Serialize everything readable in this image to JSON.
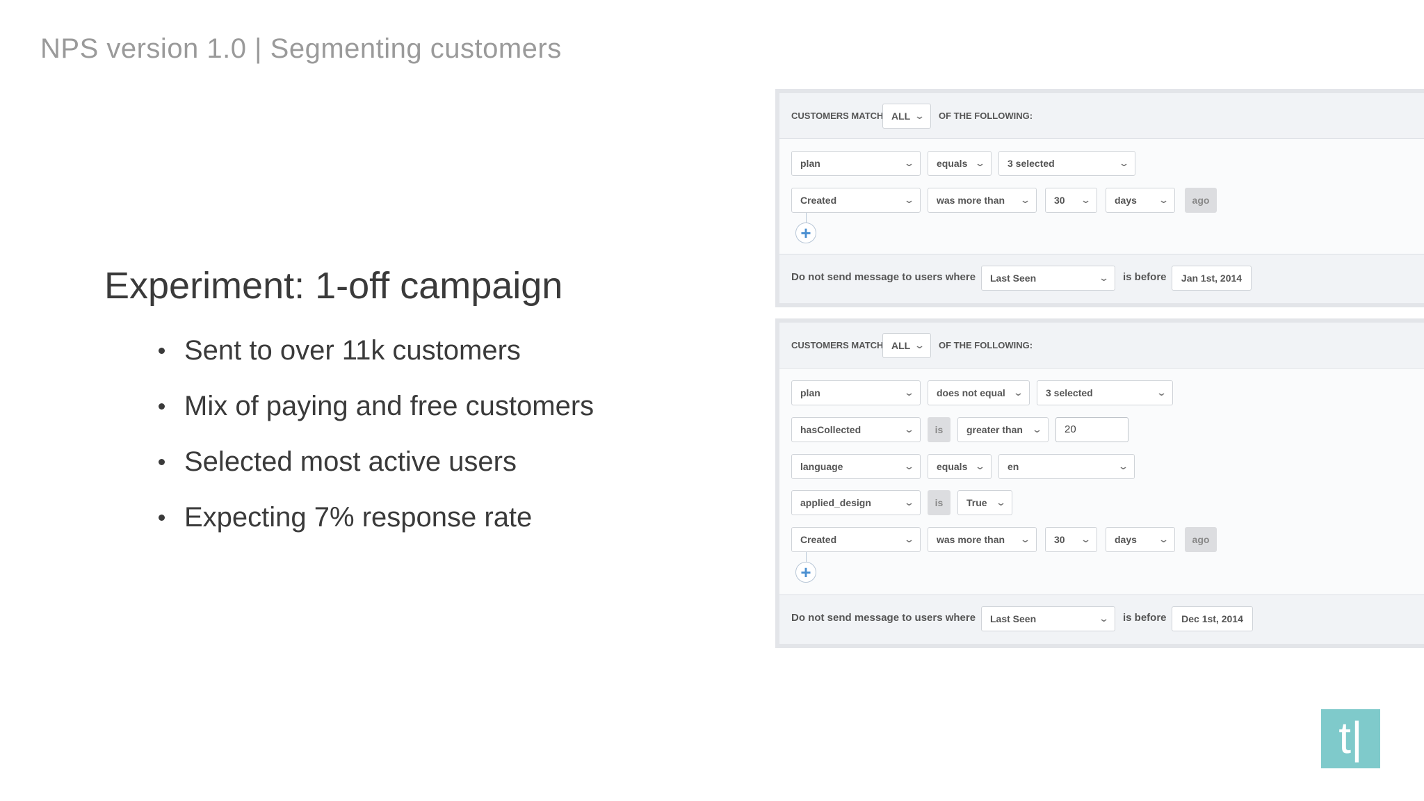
{
  "slide": {
    "title": "NPS version 1.0 | Segmenting customers",
    "heading": "Experiment: 1-off campaign",
    "bullets": [
      "Sent to over 11k customers",
      "Mix of paying and free customers",
      "Selected most active users",
      "Expecting 7% response rate"
    ],
    "logo_text": "t|"
  },
  "panel1": {
    "customers_match_label": "CUSTOMERS MATCH",
    "match_value": "ALL",
    "of_following_label": "OF THE FOLLOWING:",
    "rule1": {
      "field": "plan",
      "operator": "equals",
      "value": "3 selected"
    },
    "rule2": {
      "field": "Created",
      "operator": "was more than",
      "amount": "30",
      "unit": "days",
      "suffix": "ago"
    },
    "footer": {
      "label": "Do not send message to users where",
      "field": "Last Seen",
      "operator": "is before",
      "date": "Jan 1st, 2014"
    }
  },
  "panel2": {
    "customers_match_label": "CUSTOMERS MATCH",
    "match_value": "ALL",
    "of_following_label": "OF THE FOLLOWING:",
    "rule1": {
      "field": "plan",
      "operator": "does not equal",
      "value": "3 selected"
    },
    "rule2": {
      "field": "hasCollected",
      "is_label": "is",
      "operator": "greater than",
      "value": "20"
    },
    "rule3": {
      "field": "language",
      "operator": "equals",
      "value": "en"
    },
    "rule4": {
      "field": "applied_design",
      "is_label": "is",
      "value": "True"
    },
    "rule5": {
      "field": "Created",
      "operator": "was more than",
      "amount": "30",
      "unit": "days",
      "suffix": "ago"
    },
    "footer": {
      "label": "Do not send message to users where",
      "field": "Last Seen",
      "operator": "is before",
      "date": "Dec 1st, 2014"
    }
  },
  "icons": {
    "chevron": "⌄",
    "add": "+"
  },
  "colors": {
    "logo": "#7fcacb",
    "add_icon": "#4a8fd1"
  }
}
